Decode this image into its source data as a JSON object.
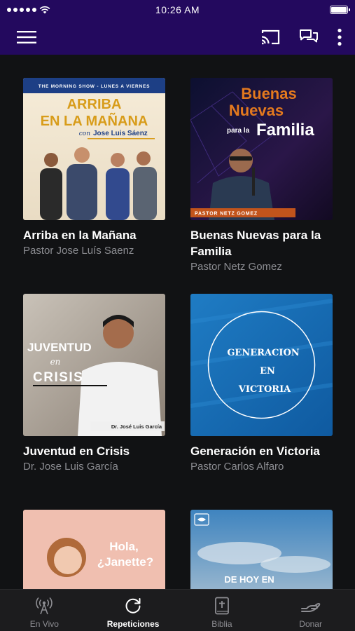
{
  "status_bar": {
    "time": "10:26 AM"
  },
  "header": {
    "icons": [
      "menu-icon",
      "cast-icon",
      "chat-icon",
      "more-vertical-icon"
    ]
  },
  "programs": [
    {
      "title": "Arriba en la Mañana",
      "subtitle": "Pastor Jose Luís Saenz",
      "art": {
        "top_line": "THE MORNING SHOW - LUNES A VIERNES",
        "heading_1": "ARRIBA",
        "heading_2": "EN LA MAÑANA",
        "con": "con",
        "host": "Jose Luis Sáenz"
      }
    },
    {
      "title": "Buenas Nuevas para la Familia",
      "subtitle": "Pastor Netz Gomez",
      "art": {
        "line_1": "Buenas",
        "line_2": "Nuevas",
        "line_3": "para la",
        "line_4": "Familia",
        "footer": "PASTOR NETZ GOMEZ"
      }
    },
    {
      "title": "Juventud en Crisis",
      "subtitle": "Dr. Jose Luis García",
      "art": {
        "line_1": "JUVENTUD",
        "line_2": "en",
        "line_3": "CRISIS",
        "footer": "Dr. José Luis García"
      }
    },
    {
      "title": "Generación en Victoria",
      "subtitle": "Pastor Carlos Alfaro",
      "art": {
        "line_1": "GENERACION",
        "line_2": "EN",
        "line_3": "VICTORIA"
      }
    },
    {
      "title": "",
      "subtitle": "",
      "art": {
        "line_1": "Hola,",
        "line_2": "¿Janette?"
      }
    },
    {
      "title": "",
      "subtitle": "",
      "art": {
        "line_1": "DE HOY EN"
      }
    }
  ],
  "tabs": [
    {
      "label": "En Vivo",
      "icon": "broadcast-icon",
      "active": false
    },
    {
      "label": "Repeticiones",
      "icon": "replay-icon",
      "active": true
    },
    {
      "label": "Biblia",
      "icon": "bible-icon",
      "active": false
    },
    {
      "label": "Donar",
      "icon": "donate-hand-icon",
      "active": false
    }
  ],
  "colors": {
    "header_bg": "#23095e",
    "page_bg": "#111214",
    "subtitle": "#8c8d92",
    "tab_bar_bg": "#1c1c1e"
  }
}
